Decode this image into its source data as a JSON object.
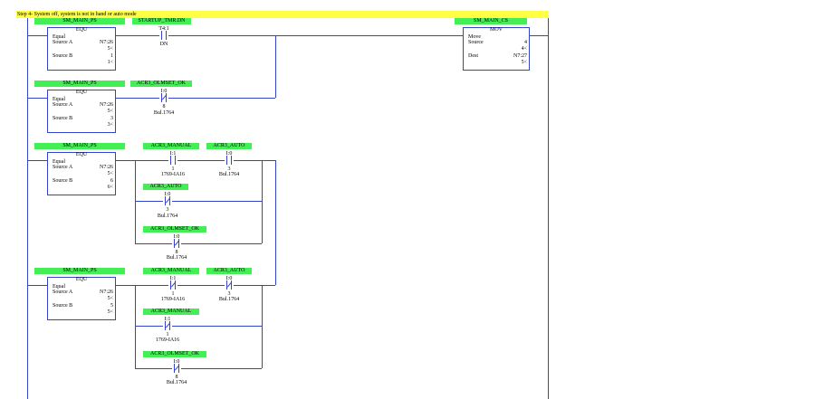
{
  "rung_comment": "Step 4- System off, system is not in hand or auto mode",
  "colors": {
    "rail": "#3344cc",
    "tag": "#44ee55",
    "comment": "#ffff44"
  },
  "rung0": {
    "equ": {
      "tag": "SM_MAIN_PS",
      "title": "EQU",
      "label": "Equal",
      "src_a_label": "Source A",
      "src_a": "N7:26",
      "src_a_val": "5<",
      "src_b_label": "Source B",
      "src_b": "1",
      "src_b_val": "1<"
    },
    "contact": {
      "tag": "STARTUP_TMR.DN",
      "addr": "T4:1",
      "bit": "DN"
    },
    "mov": {
      "tag": "SM_MAIN_CS",
      "title": "MOV",
      "label": "Move",
      "src_label": "Source",
      "src": "4",
      "src_val": "4<",
      "dest_label": "Dest",
      "dest": "N7:27",
      "dest_val": "5<"
    }
  },
  "rung1": {
    "equ": {
      "tag": "SM_MAIN_PS",
      "title": "EQU",
      "label": "Equal",
      "src_a_label": "Source A",
      "src_a": "N7:26",
      "src_a_val": "5<",
      "src_b_label": "Source B",
      "src_b": "3",
      "src_b_val": "3<"
    },
    "contact": {
      "tag": "ACR3_OLMSET_OK",
      "addr": "I:0",
      "bit": "8",
      "module": "Bul.1764"
    }
  },
  "rung2": {
    "equ": {
      "tag": "SM_MAIN_PS",
      "title": "EQU",
      "label": "Equal",
      "src_a_label": "Source A",
      "src_a": "N7:26",
      "src_a_val": "5<",
      "src_b_label": "Source B",
      "src_b": "6",
      "src_b_val": "6<"
    },
    "c1": {
      "tag": "ACR3_MANUAL",
      "addr": "I:1",
      "bit": "1",
      "module": "1769-IA16"
    },
    "c2": {
      "tag": "ACR3_AUTO",
      "addr": "I:0",
      "bit": "3",
      "module": "Bul.1764"
    },
    "c3": {
      "tag": "ACR3_AUTO",
      "addr": "I:0",
      "bit": "3",
      "module": "Bul.1764"
    },
    "c4": {
      "tag": "ACR3_OLMSET_OK",
      "addr": "I:0",
      "bit": "8",
      "module": "Bul.1764"
    }
  },
  "rung3": {
    "equ": {
      "tag": "SM_MAIN_PS",
      "title": "EQU",
      "label": "Equal",
      "src_a_label": "Source A",
      "src_a": "N7:26",
      "src_a_val": "5<",
      "src_b_label": "Source B",
      "src_b": "5",
      "src_b_val": "5<"
    },
    "c1": {
      "tag": "ACR3_MANUAL",
      "addr": "I:1",
      "bit": "1",
      "module": "1769-IA16"
    },
    "c2": {
      "tag": "ACR3_AUTO",
      "addr": "I:0",
      "bit": "3",
      "module": "Bul.1764"
    },
    "c3": {
      "tag": "ACR3_MANUAL",
      "addr": "I:1",
      "bit": "1",
      "module": "1769-IA16"
    },
    "c4": {
      "tag": "ACR3_OLMSET_OK",
      "addr": "I:0",
      "bit": "8",
      "module": "Bul.1764"
    }
  }
}
